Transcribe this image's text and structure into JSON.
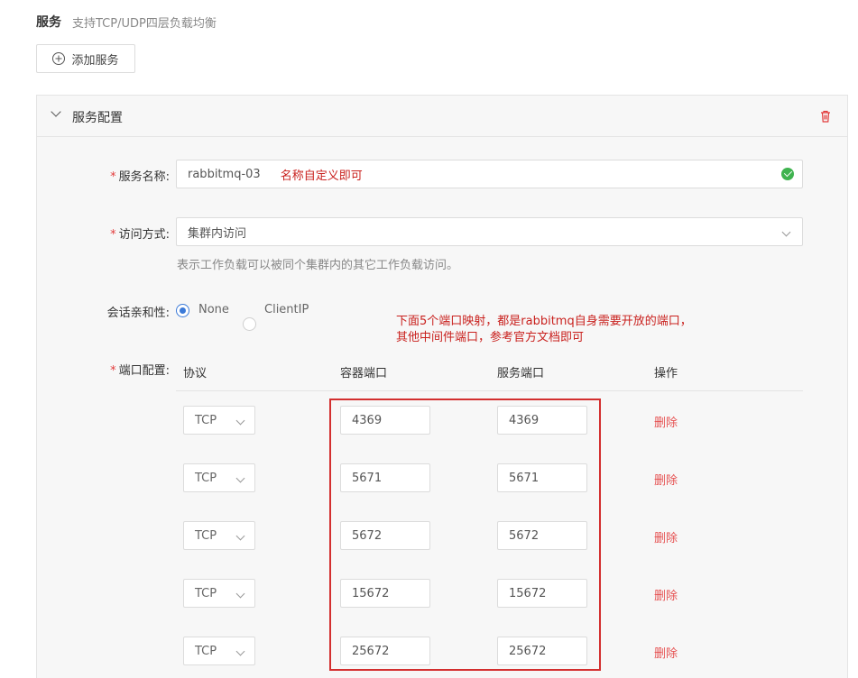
{
  "header": {
    "title": "服务",
    "subtitle": "支持TCP/UDP四层负载均衡"
  },
  "add_service_label": "添加服务",
  "panel": {
    "title": "服务配置"
  },
  "form": {
    "service_name": {
      "label": "服务名称:",
      "value": "rabbitmq-03",
      "annotation": "名称自定义即可"
    },
    "access_mode": {
      "label": "访问方式:",
      "value": "集群内访问",
      "hint": "表示工作负载可以被同个集群内的其它工作负载访问。"
    },
    "session_affinity": {
      "label": "会话亲和性:",
      "options": [
        "None",
        "ClientIP"
      ],
      "selected": "None"
    },
    "annotation_lines": [
      "下面5个端口映射，都是rabbitmq自身需要开放的端口，",
      "其他中间件端口，参考官方文档即可"
    ],
    "ports": {
      "label": "端口配置:",
      "columns": [
        "协议",
        "容器端口",
        "服务端口",
        "操作"
      ],
      "rows": [
        {
          "protocol": "TCP",
          "container_port": "4369",
          "service_port": "4369",
          "action": "删除"
        },
        {
          "protocol": "TCP",
          "container_port": "5671",
          "service_port": "5671",
          "action": "删除"
        },
        {
          "protocol": "TCP",
          "container_port": "5672",
          "service_port": "5672",
          "action": "删除"
        },
        {
          "protocol": "TCP",
          "container_port": "15672",
          "service_port": "15672",
          "action": "删除"
        },
        {
          "protocol": "TCP",
          "container_port": "25672",
          "service_port": "25672",
          "action": "删除"
        }
      ]
    }
  },
  "colors": {
    "required": "#e23b3b",
    "annotation": "#c9211e",
    "delete": "#e65151",
    "radio_selected": "#3b7ad8",
    "valid": "#3fb34f",
    "highlight_box": "#d32f2f"
  },
  "icons": {
    "add": "plus-circle-icon",
    "collapse": "chevron-down-icon",
    "delete_panel": "trash-icon",
    "valid": "check-circle-icon",
    "select": "chevron-down-icon"
  }
}
